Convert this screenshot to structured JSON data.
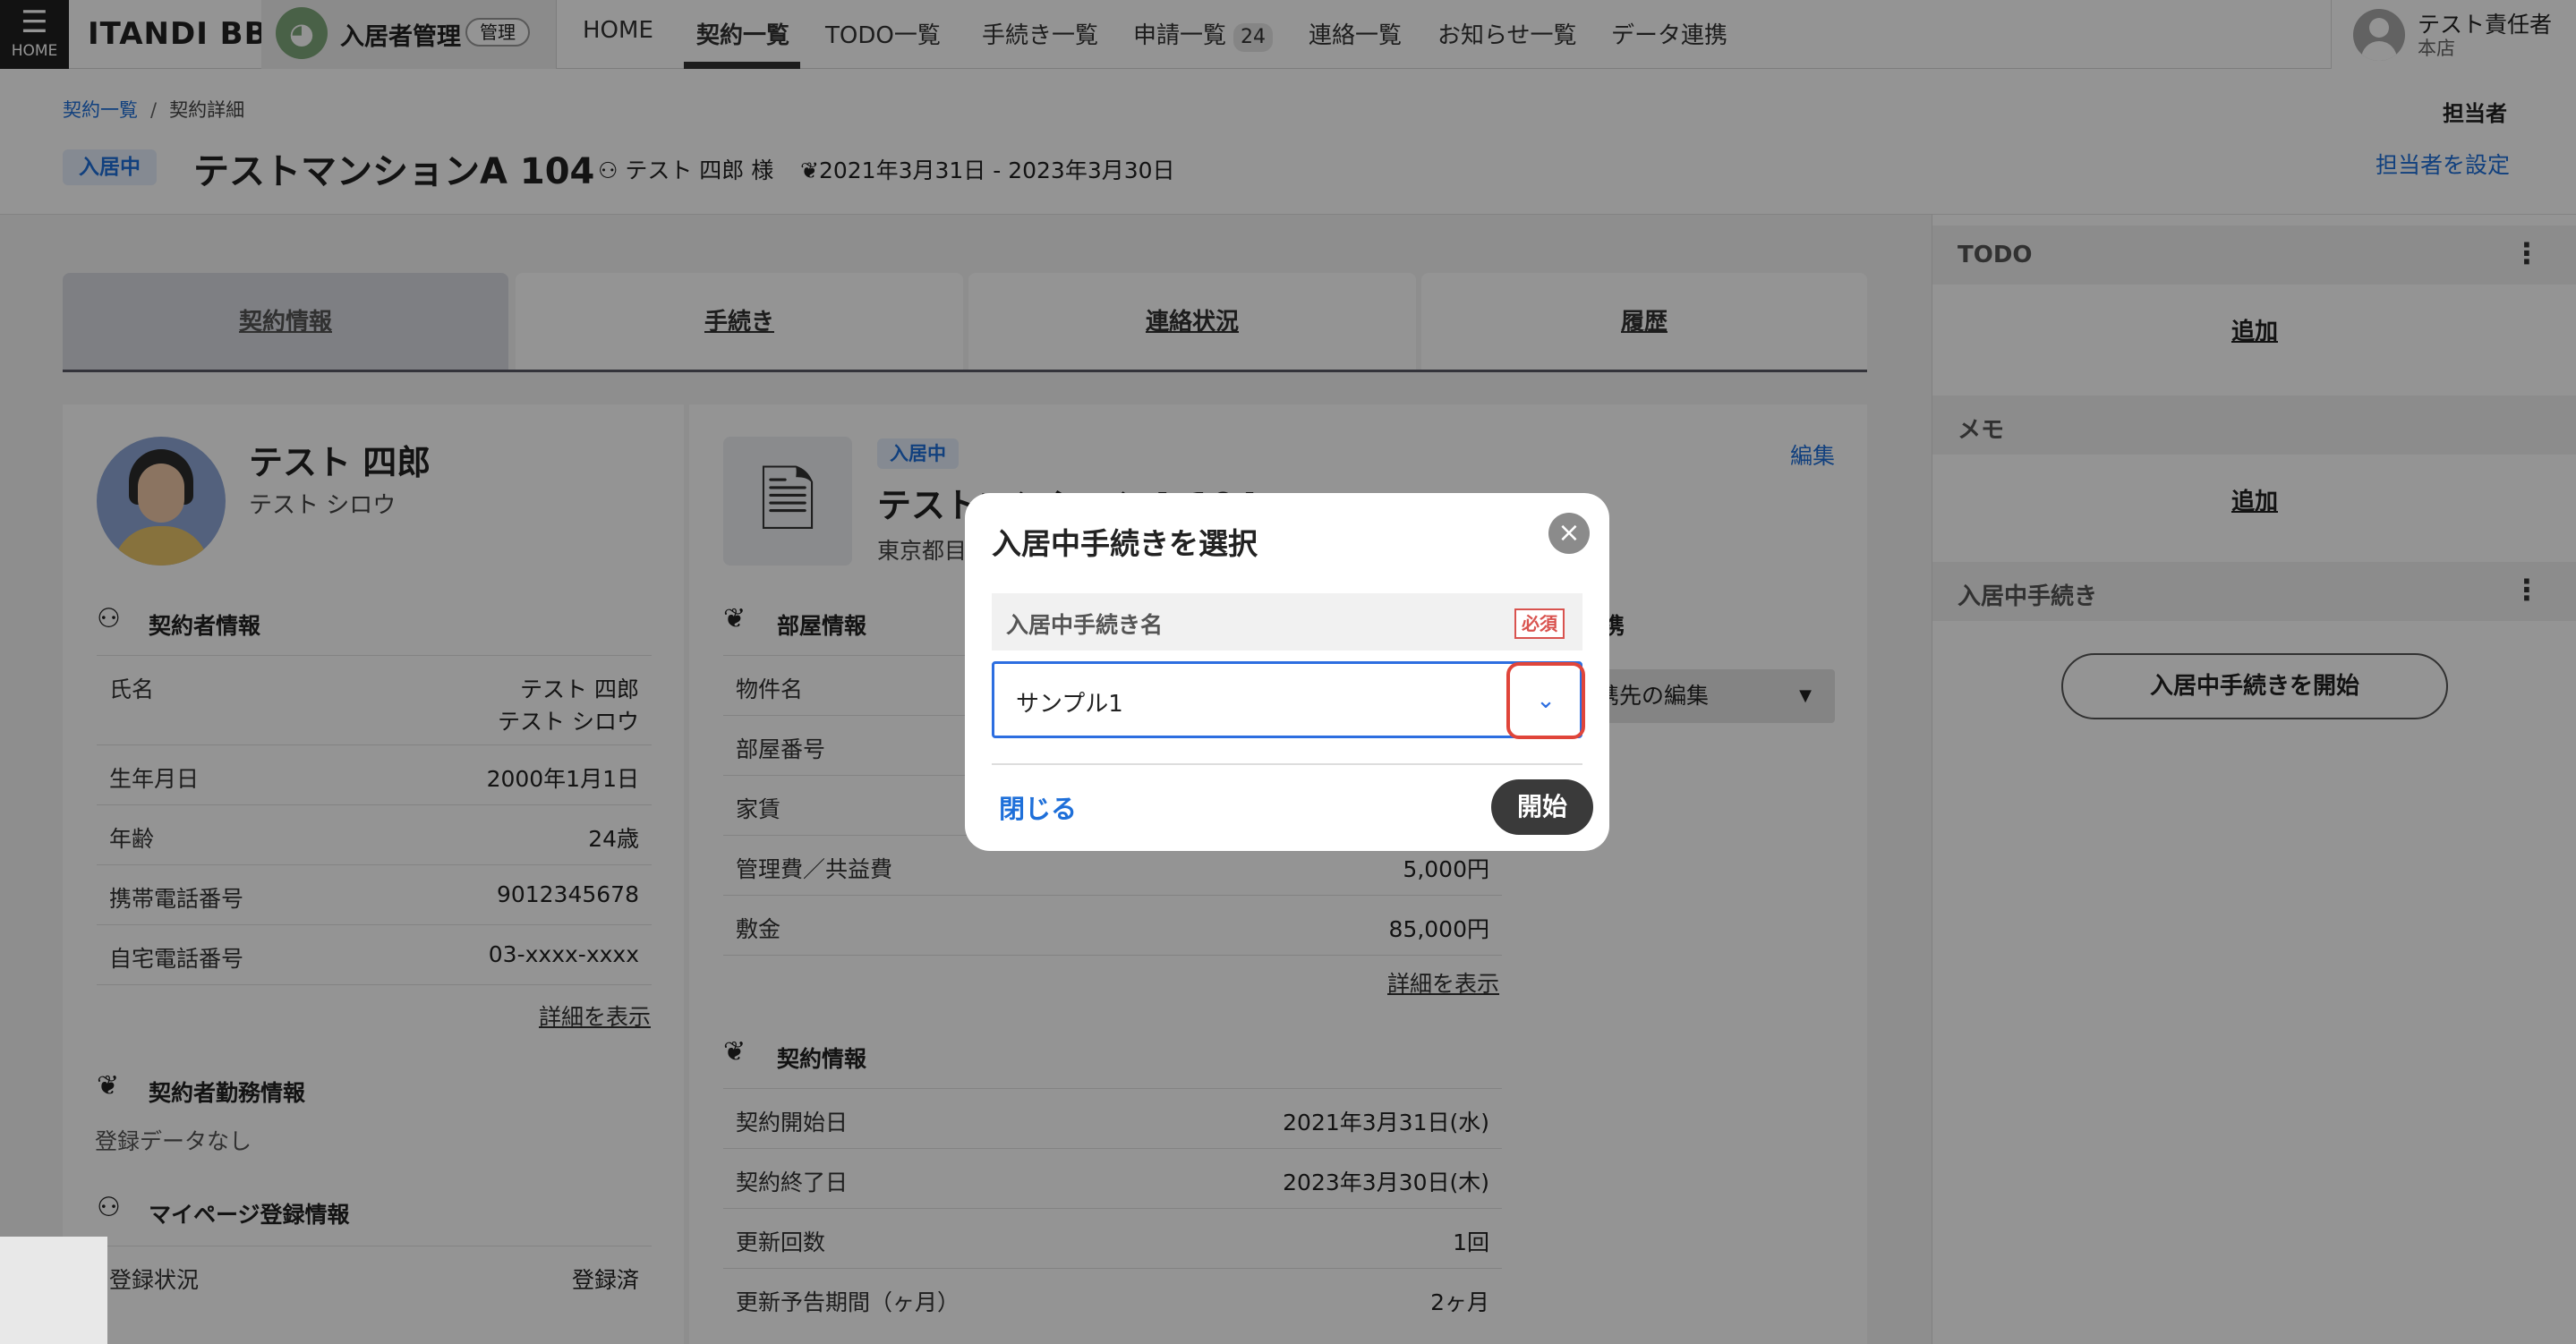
{
  "nav": {
    "menu_icon": "☰",
    "menu_label": "HOME",
    "logo": "ITANDI BB",
    "app_icon": "app-mascot-icon",
    "app_name": "入居者管理",
    "app_badge": "管理",
    "links": [
      {
        "label": "HOME"
      },
      {
        "label": "契約一覧"
      },
      {
        "label": "TODO一覧"
      },
      {
        "label": "手続き一覧"
      },
      {
        "label": "申請一覧"
      },
      {
        "label": "連絡一覧"
      },
      {
        "label": "お知らせ一覧"
      },
      {
        "label": "データ連携"
      }
    ],
    "application_count": "24",
    "user": {
      "name": "テスト責任者",
      "store": "本店"
    }
  },
  "header": {
    "breadcrumb": {
      "parent": "契約一覧",
      "separator": "/",
      "current": "契約詳細"
    },
    "status": "入居中",
    "property_title": "テストマンションA 104",
    "tenant": "テスト 四郎 様",
    "period": "2021年3月31日 - 2023年3月30日",
    "assignee_title": "担当者",
    "assignee_link": "担当者を設定"
  },
  "tabs": [
    {
      "label": "契約情報"
    },
    {
      "label": "手続き"
    },
    {
      "label": "連絡状況"
    },
    {
      "label": "履歴"
    }
  ],
  "person": {
    "name": "テスト 四郎",
    "kana": "テスト シロウ",
    "contractor_section": "契約者情報",
    "rows": [
      {
        "key": "氏名",
        "value": "テスト 四郎",
        "value2": "テスト シロウ"
      },
      {
        "key": "生年月日",
        "value": "2000年1月1日"
      },
      {
        "key": "年齢",
        "value": "24歳"
      },
      {
        "key": "携帯電話番号",
        "value": "9012345678"
      },
      {
        "key": "自宅電話番号",
        "value": "03-xxxx-xxxx"
      }
    ],
    "more_link": "詳細を表示",
    "work_section": "契約者勤務情報",
    "work_empty": "登録データなし",
    "mypage_section": "マイページ登録情報",
    "mypage_row": {
      "key": "登録状況",
      "value": "登録済"
    }
  },
  "property": {
    "status": "入居中",
    "name": "テストマンションA 104",
    "address": "東京都目",
    "edit": "編集",
    "room_section": "部屋情報",
    "room_rows": [
      {
        "key": "物件名",
        "value": ""
      },
      {
        "key": "部屋番号",
        "value": ""
      },
      {
        "key": "家賃",
        "value": ""
      },
      {
        "key": "管理費／共益費",
        "value": "5,000円"
      },
      {
        "key": "敷金",
        "value": "85,000円"
      }
    ],
    "more_link": "詳細を表示",
    "contract_section": "契約情報",
    "contract_rows": [
      {
        "key": "契約開始日",
        "value": "2021年3月31日(水)"
      },
      {
        "key": "契約終了日",
        "value": "2023年3月30日(木)"
      },
      {
        "key": "更新回数",
        "value": "1回"
      },
      {
        "key": "更新予告期間（ヶ月）",
        "value": "2ヶ月"
      }
    ],
    "cooperate_title": "携",
    "cooperate_select": "携先の編集"
  },
  "sidebar": {
    "todo_title": "TODO",
    "todo_add": "追加",
    "memo_title": "メモ",
    "memo_add": "追加",
    "procedure_title": "入居中手続き",
    "procedure_button": "入居中手続きを開始",
    "menu_icon": "⋮"
  },
  "modal": {
    "title": "入居中手続きを選択",
    "close_icon": "×",
    "field_label": "入居中手続き名",
    "required": "必須",
    "selected_value": "サンプル1",
    "dropdown_icon": "⌄",
    "close_label": "閉じる",
    "start_label": "開始"
  }
}
